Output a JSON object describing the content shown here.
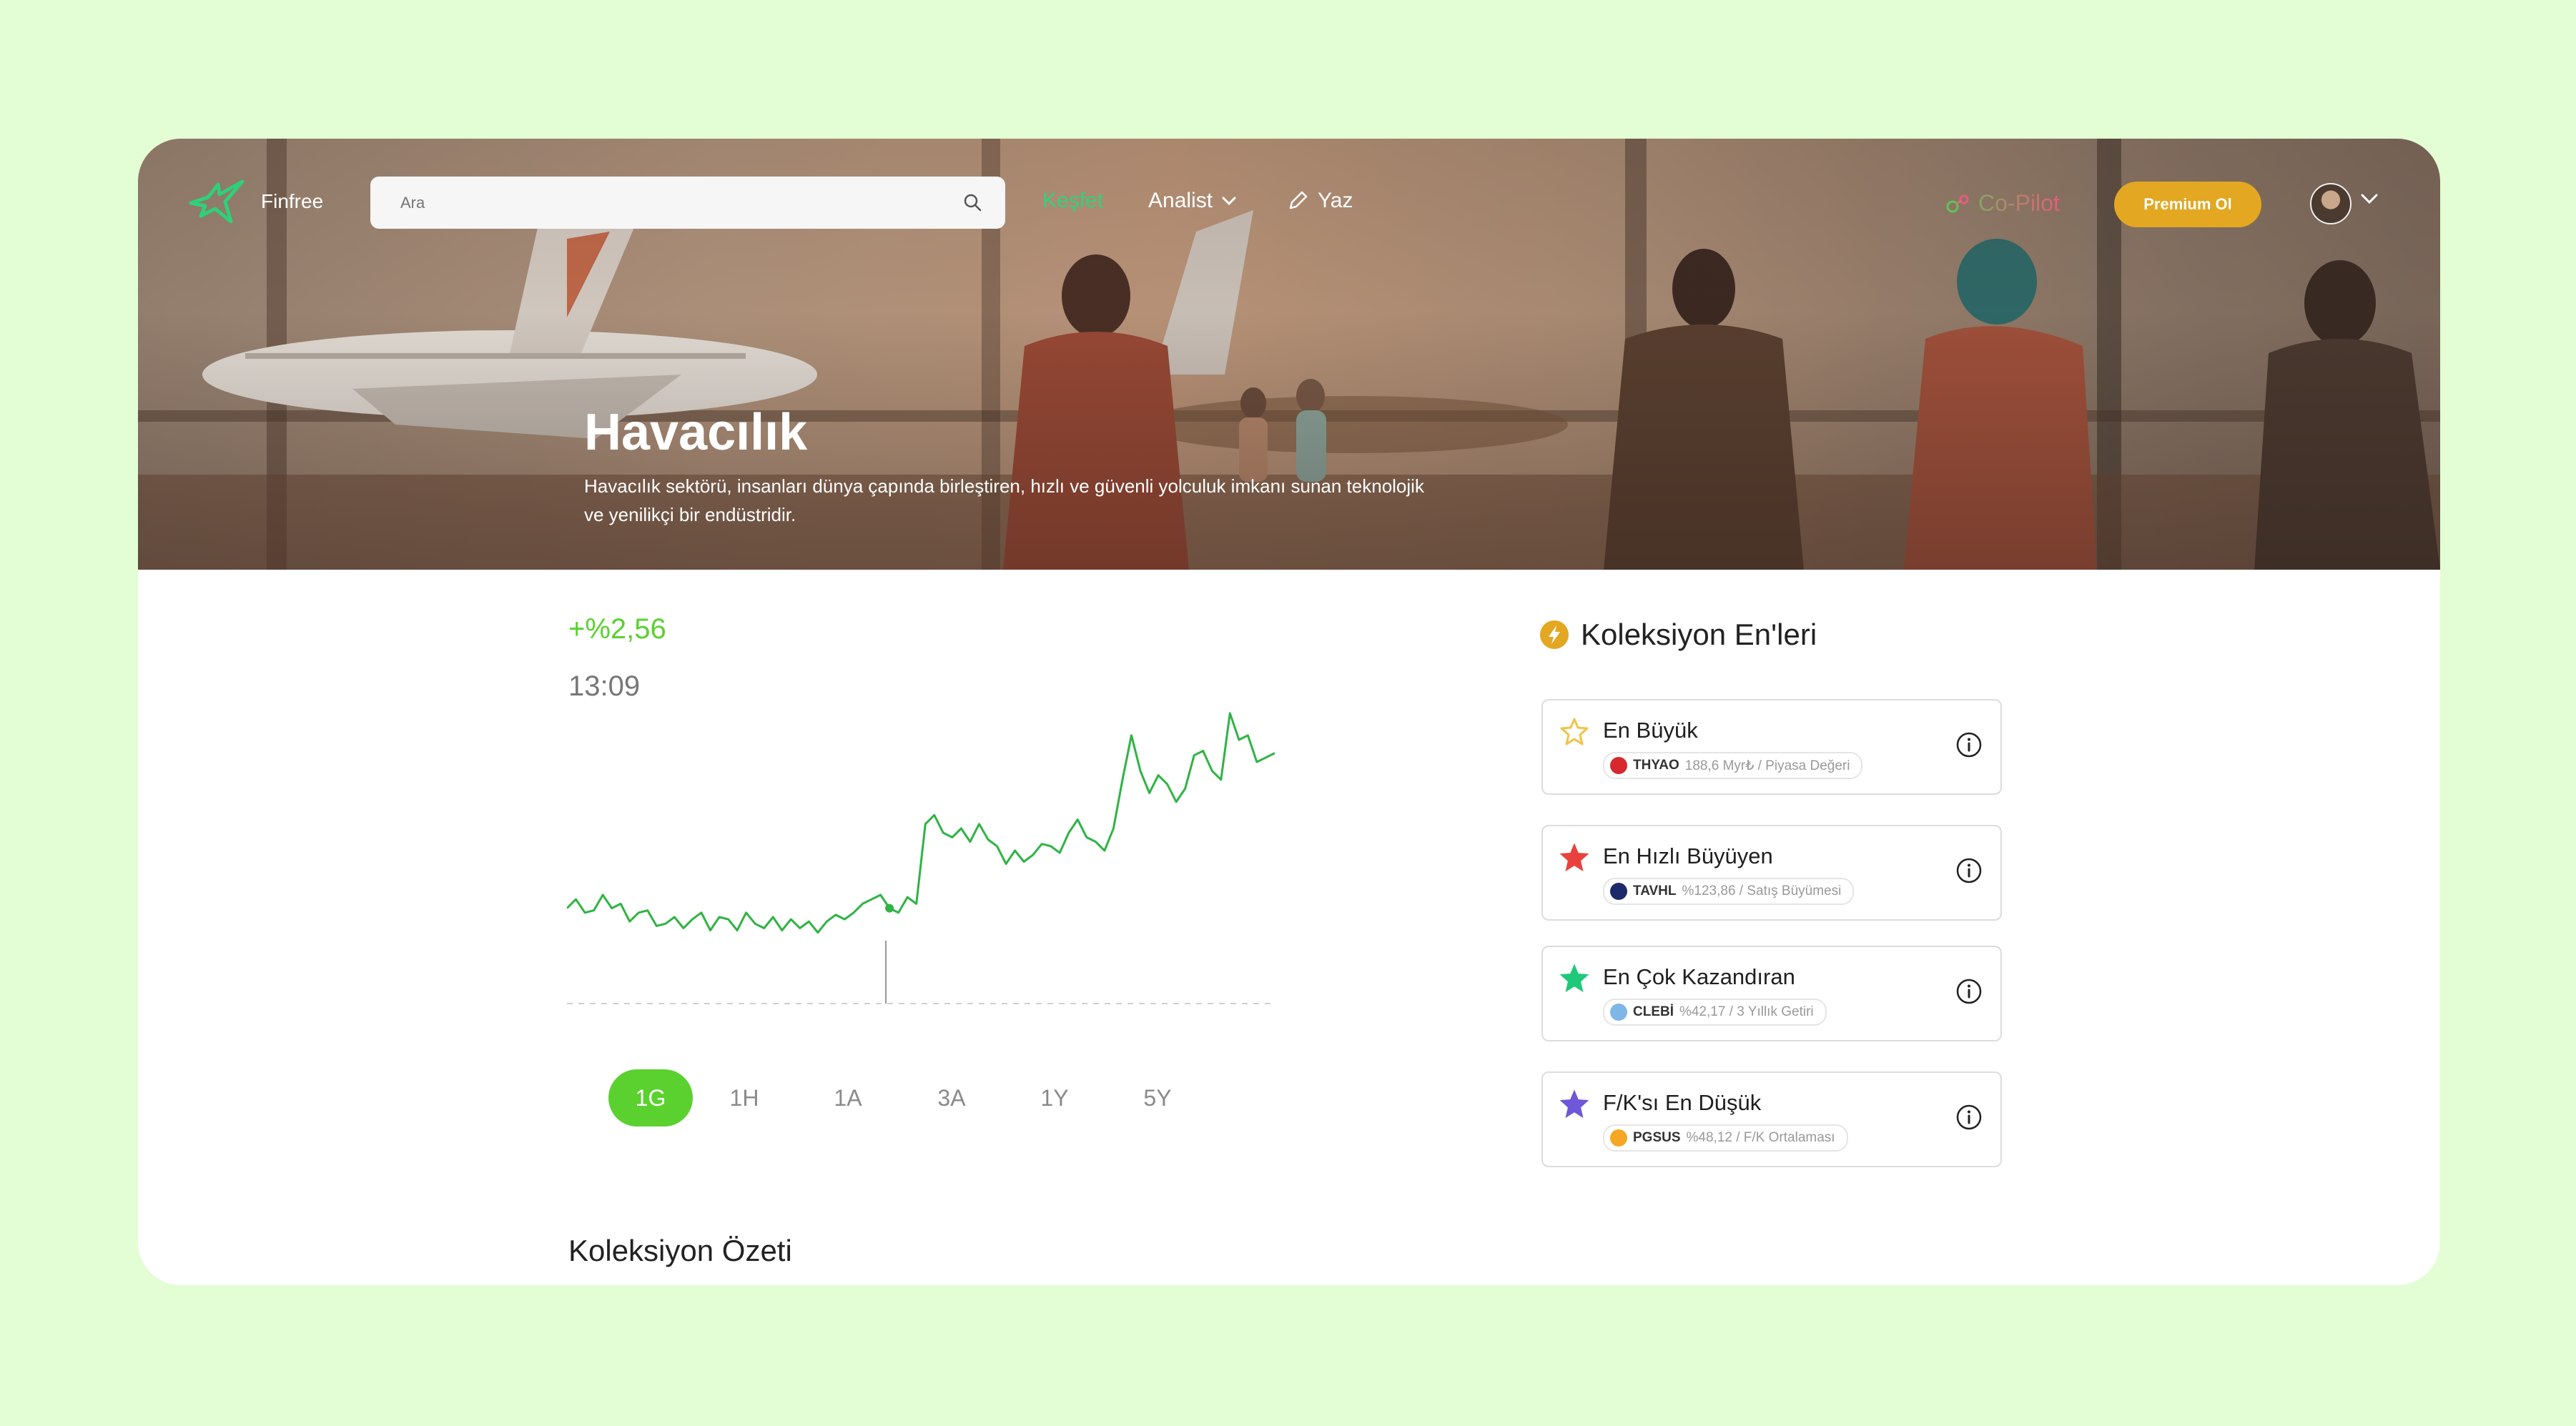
{
  "header": {
    "brand": "Finfree",
    "search_placeholder": "Ara",
    "nav": [
      {
        "label": "Keşfet",
        "active": true
      },
      {
        "label": "Analist",
        "active": false
      },
      {
        "label": "Yaz",
        "active": false
      }
    ],
    "copilot_label": "Co-Pilot",
    "premium_label": "Premium Ol"
  },
  "hero": {
    "title": "Havacılık",
    "description": "Havacılık sektörü, insanları dünya çapında birleştiren, hızlı ve güvenli yolculuk imkanı sunan teknolojik ve yenilikçi bir endüstridir."
  },
  "chart": {
    "change": "+%2,56",
    "time": "13:09",
    "ranges": [
      "1G",
      "1H",
      "1A",
      "3A",
      "1Y",
      "5Y"
    ],
    "active_range": "1G",
    "line_color": "#2fb344"
  },
  "chart_data": {
    "type": "line",
    "x": [
      0,
      1,
      2,
      3,
      4,
      5,
      6,
      7,
      8,
      9,
      10,
      11,
      12,
      13,
      14,
      15,
      16,
      17,
      18,
      19,
      20,
      21,
      22,
      23,
      24,
      25,
      26,
      27,
      28,
      29,
      30,
      31,
      32,
      33,
      34,
      35,
      36,
      37,
      38,
      39,
      40,
      41,
      42,
      43,
      44,
      45,
      46,
      47,
      48,
      49,
      50,
      51,
      52,
      53,
      54,
      55,
      56,
      57,
      58,
      59,
      60,
      61,
      62,
      63,
      64,
      65,
      66,
      67,
      68,
      69,
      70,
      71,
      72,
      73,
      74,
      75,
      76,
      77,
      78,
      79
    ],
    "values": [
      0.14,
      0.18,
      0.12,
      0.13,
      0.2,
      0.14,
      0.16,
      0.08,
      0.12,
      0.13,
      0.06,
      0.07,
      0.1,
      0.05,
      0.09,
      0.12,
      0.04,
      0.1,
      0.09,
      0.04,
      0.12,
      0.07,
      0.05,
      0.1,
      0.04,
      0.09,
      0.05,
      0.08,
      0.03,
      0.08,
      0.11,
      0.09,
      0.12,
      0.16,
      0.18,
      0.2,
      0.14,
      0.12,
      0.19,
      0.16,
      0.52,
      0.56,
      0.48,
      0.46,
      0.5,
      0.44,
      0.52,
      0.45,
      0.42,
      0.34,
      0.4,
      0.35,
      0.38,
      0.43,
      0.42,
      0.39,
      0.48,
      0.54,
      0.46,
      0.44,
      0.4,
      0.5,
      0.72,
      0.92,
      0.76,
      0.66,
      0.74,
      0.7,
      0.62,
      0.68,
      0.83,
      0.85,
      0.76,
      0.72,
      1.02,
      0.9,
      0.92,
      0.8,
      0.82,
      0.84
    ],
    "xlabel": "",
    "ylabel": "",
    "grid": false,
    "baseline": "dashed"
  },
  "collection": {
    "title": "Koleksiyon En'leri",
    "summary_title": "Koleksiyon Özeti",
    "items": [
      {
        "title": "En Büyük",
        "ticker": "THYAO",
        "metric": "188,6 Myr₺ / Piyasa Değeri",
        "star_color": "#f0c34a",
        "logo_color": "#d6282d"
      },
      {
        "title": "En Hızlı Büyüyen",
        "ticker": "TAVHL",
        "metric": "%123,86 / Satış Büyümesi",
        "star_color": "#e9423e",
        "logo_color": "#1c2a6b"
      },
      {
        "title": "En Çok Kazandıran",
        "ticker": "CLEBİ",
        "metric": "%42,17 / 3 Yıllık Getiri",
        "star_color": "#1fc97a",
        "logo_color": "#7fb6e8"
      },
      {
        "title": "F/K'sı En Düşük",
        "ticker": "PGSUS",
        "metric": "%48,12 / F/K Ortalaması",
        "star_color": "#6e57d9",
        "logo_color": "#f5a623"
      }
    ]
  }
}
